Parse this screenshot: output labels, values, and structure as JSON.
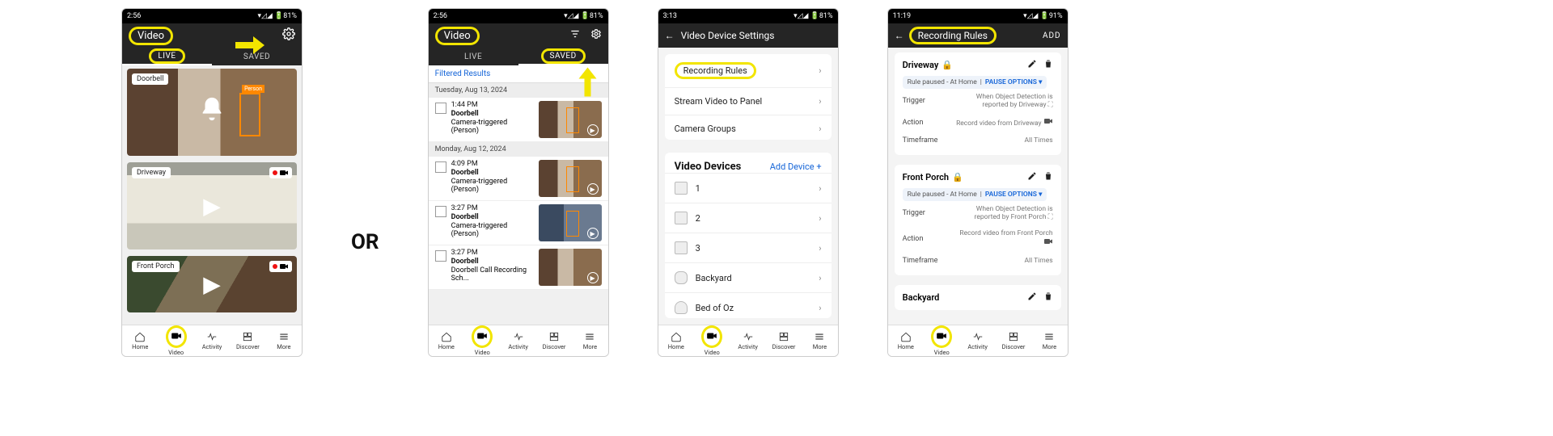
{
  "or_label": "OR",
  "screen1": {
    "status": {
      "time": "2:56",
      "icons": "⏰ ⋈",
      "right": "▾◿◢ 🔋81%"
    },
    "title": "Video",
    "tabs": {
      "live": "LIVE",
      "saved": "SAVED"
    },
    "tiles": [
      {
        "label": "Doorbell",
        "person": "Person"
      },
      {
        "label": "Driveway"
      },
      {
        "label": "Front Porch"
      }
    ]
  },
  "screen2": {
    "status": {
      "time": "2:56",
      "icons": "⏰ ⋈",
      "right": "▾◿◢ 🔋81%"
    },
    "title": "Video",
    "tabs": {
      "live": "LIVE",
      "saved": "SAVED"
    },
    "filtered": "Filtered Results",
    "groups": [
      {
        "date": "Tuesday, Aug 13, 2024",
        "clips": [
          {
            "time": "1:44 PM",
            "name": "Doorbell",
            "desc": "Camera-triggered (Person)"
          }
        ]
      },
      {
        "date": "Monday, Aug 12, 2024",
        "clips": [
          {
            "time": "4:09 PM",
            "name": "Doorbell",
            "desc": "Camera-triggered (Person)"
          },
          {
            "time": "3:27 PM",
            "name": "Doorbell",
            "desc": "Camera-triggered (Person)"
          },
          {
            "time": "3:27 PM",
            "name": "Doorbell",
            "desc": "Doorbell Call Recording Sch..."
          }
        ]
      }
    ]
  },
  "screen3": {
    "status": {
      "time": "3:13",
      "icons": "",
      "right": "▾◿◢ 🔋81%"
    },
    "title": "Video Device Settings",
    "rows": [
      "Recording Rules",
      "Stream Video to Panel",
      "Camera Groups"
    ],
    "video_devices_label": "Video Devices",
    "add_device_label": "Add Device  +",
    "devices": [
      "1",
      "2",
      "3",
      "Backyard",
      "Bed of Oz"
    ]
  },
  "screen4": {
    "status": {
      "time": "11:19",
      "icons": "",
      "right": "▾◿◢ 🔋91%"
    },
    "title": "Recording Rules",
    "add": "ADD",
    "rules": [
      {
        "name": "Driveway",
        "pause": "Rule paused - At Home",
        "pauseopt": "PAUSE OPTIONS ▾",
        "trigger_label": "Trigger",
        "trigger": "When Object Detection is reported by Driveway",
        "action_label": "Action",
        "action": "Record video from Driveway",
        "timeframe_label": "Timeframe",
        "timeframe": "All Times"
      },
      {
        "name": "Front Porch",
        "pause": "Rule paused - At Home",
        "pauseopt": "PAUSE OPTIONS ▾",
        "trigger_label": "Trigger",
        "trigger": "When Object Detection is reported by Front Porch",
        "action_label": "Action",
        "action": "Record video from Front Porch",
        "timeframe_label": "Timeframe",
        "timeframe": "All Times"
      },
      {
        "name": "Backyard"
      }
    ]
  },
  "nav": {
    "home": "Home",
    "video": "Video",
    "activity": "Activity",
    "discover": "Discover",
    "more": "More"
  }
}
